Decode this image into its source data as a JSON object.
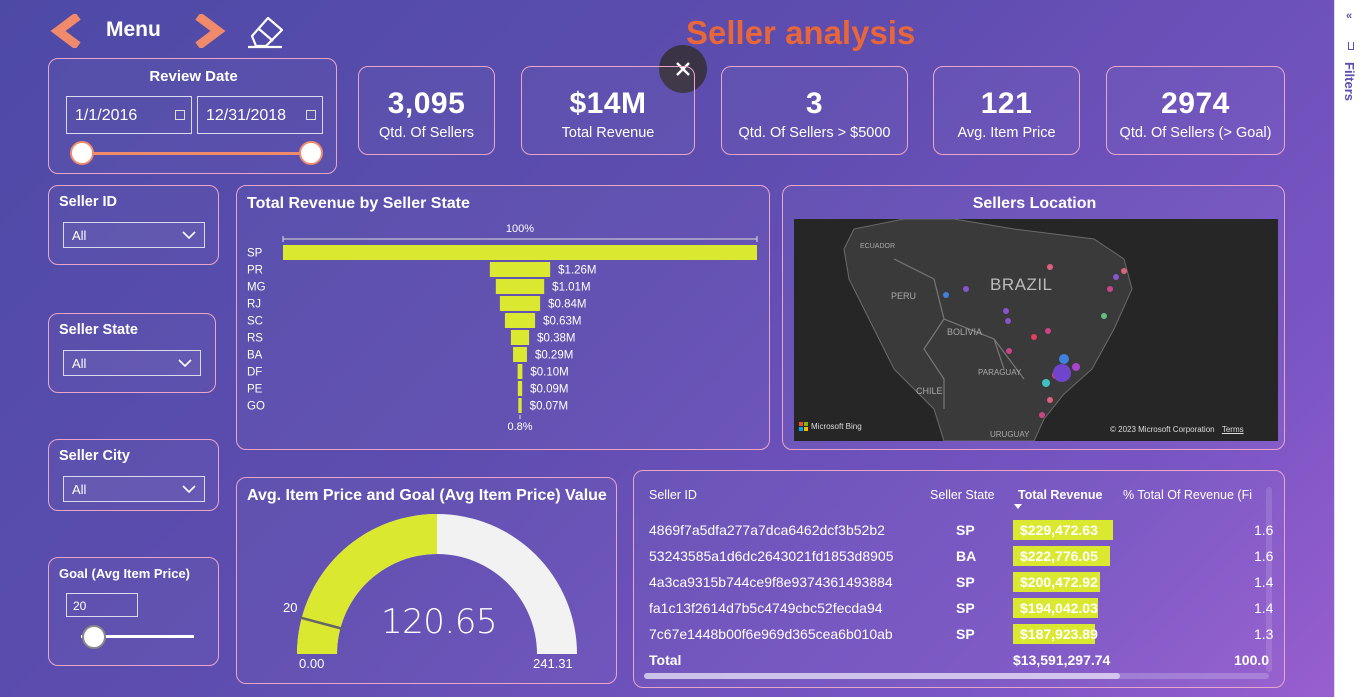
{
  "header": {
    "menu_label": "Menu",
    "title": "Seller analysis"
  },
  "colors": {
    "accent": "#e7663a",
    "bar": "#dbe830",
    "border": "#e8a6c8",
    "map_bg": "#2b2b2b"
  },
  "review_date": {
    "title": "Review Date",
    "start": "1/1/2016",
    "end": "12/31/2018"
  },
  "kpis": [
    {
      "value": "3,095",
      "label": "Qtd. Of Sellers"
    },
    {
      "value": "$14M",
      "label": "Total Revenue"
    },
    {
      "value": "3",
      "label": "Qtd. Of Sellers > $5000"
    },
    {
      "value": "121",
      "label": "Avg. Item Price"
    },
    {
      "value": "2974",
      "label": "Qtd. Of Sellers (> Goal)"
    }
  ],
  "slicers": {
    "seller_id": {
      "title": "Seller ID",
      "value": "All"
    },
    "seller_state": {
      "title": "Seller State",
      "value": "All"
    },
    "seller_city": {
      "title": "Seller City",
      "value": "All"
    },
    "goal": {
      "title": "Goal (Avg Item Price)",
      "value": "20"
    }
  },
  "funnel": {
    "title": "Total Revenue by Seller State",
    "top_pct": "100%",
    "bottom_pct": "0.8%"
  },
  "chart_data": {
    "type": "bar",
    "title": "Total Revenue by Seller State",
    "categories": [
      "SP",
      "PR",
      "MG",
      "RJ",
      "SC",
      "RS",
      "BA",
      "DF",
      "PE",
      "GO"
    ],
    "values": [
      9.9,
      1.26,
      1.01,
      0.84,
      0.63,
      0.38,
      0.29,
      0.1,
      0.09,
      0.07
    ],
    "labels": [
      "",
      "$1.26M",
      "$1.01M",
      "$0.84M",
      "$0.63M",
      "$0.38M",
      "$0.29M",
      "$0.10M",
      "$0.09M",
      "$0.07M"
    ],
    "unit": "M"
  },
  "map": {
    "title": "Sellers Location",
    "country_labels": [
      "ECUADOR",
      "BRAZIL",
      "PERU",
      "BOLIVIA",
      "PARAGUAY",
      "CHILE",
      "URUGUAY"
    ],
    "attribution_left": "Microsoft Bing",
    "attribution_right": "© 2023 Microsoft Corporation",
    "terms": "Terms"
  },
  "gauge": {
    "title": "Avg. Item Price and Goal (Avg Item Price) Value",
    "value": 120.65,
    "value_text": "120.65",
    "min": 0,
    "min_text": "0.00",
    "max": 241.31,
    "max_text": "241.31",
    "target": 20,
    "target_text": "20"
  },
  "table": {
    "headers": [
      "Seller ID",
      "Seller State",
      "Total Revenue",
      "% Total Of Revenue (Fi"
    ],
    "rows": [
      {
        "id": "4869f7a5dfa277a7dca6462dcf3b52b2",
        "state": "SP",
        "revenue": "$229,472.63",
        "share": 1.0,
        "pct": "1.6"
      },
      {
        "id": "53243585a1d6dc2643021fd1853d8905",
        "state": "BA",
        "revenue": "$222,776.05",
        "share": 0.97,
        "pct": "1.6"
      },
      {
        "id": "4a3ca9315b744ce9f8e9374361493884",
        "state": "SP",
        "revenue": "$200,472.92",
        "share": 0.874,
        "pct": "1.4"
      },
      {
        "id": "fa1c13f2614d7b5c4749cbc52fecda94",
        "state": "SP",
        "revenue": "$194,042.03",
        "share": 0.846,
        "pct": "1.4"
      },
      {
        "id": "7c67e1448b00f6e969d365cea6b010ab",
        "state": "SP",
        "revenue": "$187,923.89",
        "share": 0.819,
        "pct": "1.3"
      }
    ],
    "total_label": "Total",
    "total_revenue": "$13,591,297.74",
    "total_pct": "100.0"
  },
  "filters_label": "Filters"
}
